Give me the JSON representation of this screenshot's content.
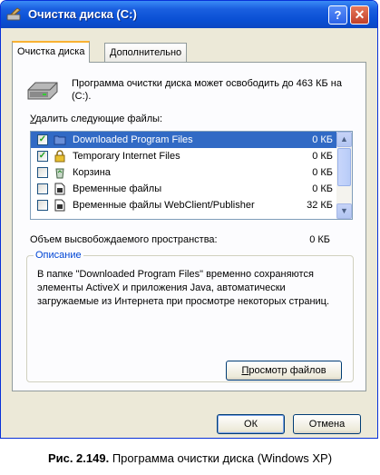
{
  "window": {
    "title": "Очистка диска  (C:)",
    "help_glyph": "?",
    "close_glyph": "✕"
  },
  "tabs": [
    {
      "label": "Очистка диска",
      "active": true
    },
    {
      "label": "Дополнительно",
      "active": false
    }
  ],
  "info": {
    "text": "Программа очистки диска может освободить до 463 КБ на  (C:)."
  },
  "delete_label": {
    "u": "У",
    "rest": "далить следующие файлы:"
  },
  "files": [
    {
      "name": "Downloaded Program Files",
      "size": "0 КБ",
      "checked": true,
      "selected": true,
      "icon": "folder-icon"
    },
    {
      "name": "Temporary Internet Files",
      "size": "0 КБ",
      "checked": true,
      "selected": false,
      "icon": "lock-icon"
    },
    {
      "name": "Корзина",
      "size": "0 КБ",
      "checked": false,
      "selected": false,
      "icon": "recycle-bin-icon"
    },
    {
      "name": "Временные файлы",
      "size": "0 КБ",
      "checked": false,
      "selected": false,
      "icon": "file-icon"
    },
    {
      "name": "Временные файлы WebClient/Publisher",
      "size": "32 КБ",
      "checked": false,
      "selected": false,
      "icon": "file-icon"
    }
  ],
  "space": {
    "label": "Объем высвобождаемого пространства:",
    "value": "0 КБ"
  },
  "description": {
    "title": "Описание",
    "text": "В папке \"Downloaded Program Files\" временно сохраняются элементы ActiveX и приложения Java, автоматически загружаемые из Интернета при просмотре некоторых страниц."
  },
  "buttons": {
    "view_u": "П",
    "view_rest": "росмотр файлов",
    "ok": "ОК",
    "cancel": "Отмена"
  },
  "caption": {
    "bold": "Рис. 2.149.",
    "text": " Программа очистки диска (Windows XP)"
  },
  "colors": {
    "title_bar": "#0a4fd4",
    "selection": "#316ac5",
    "group_title": "#0046d5"
  }
}
